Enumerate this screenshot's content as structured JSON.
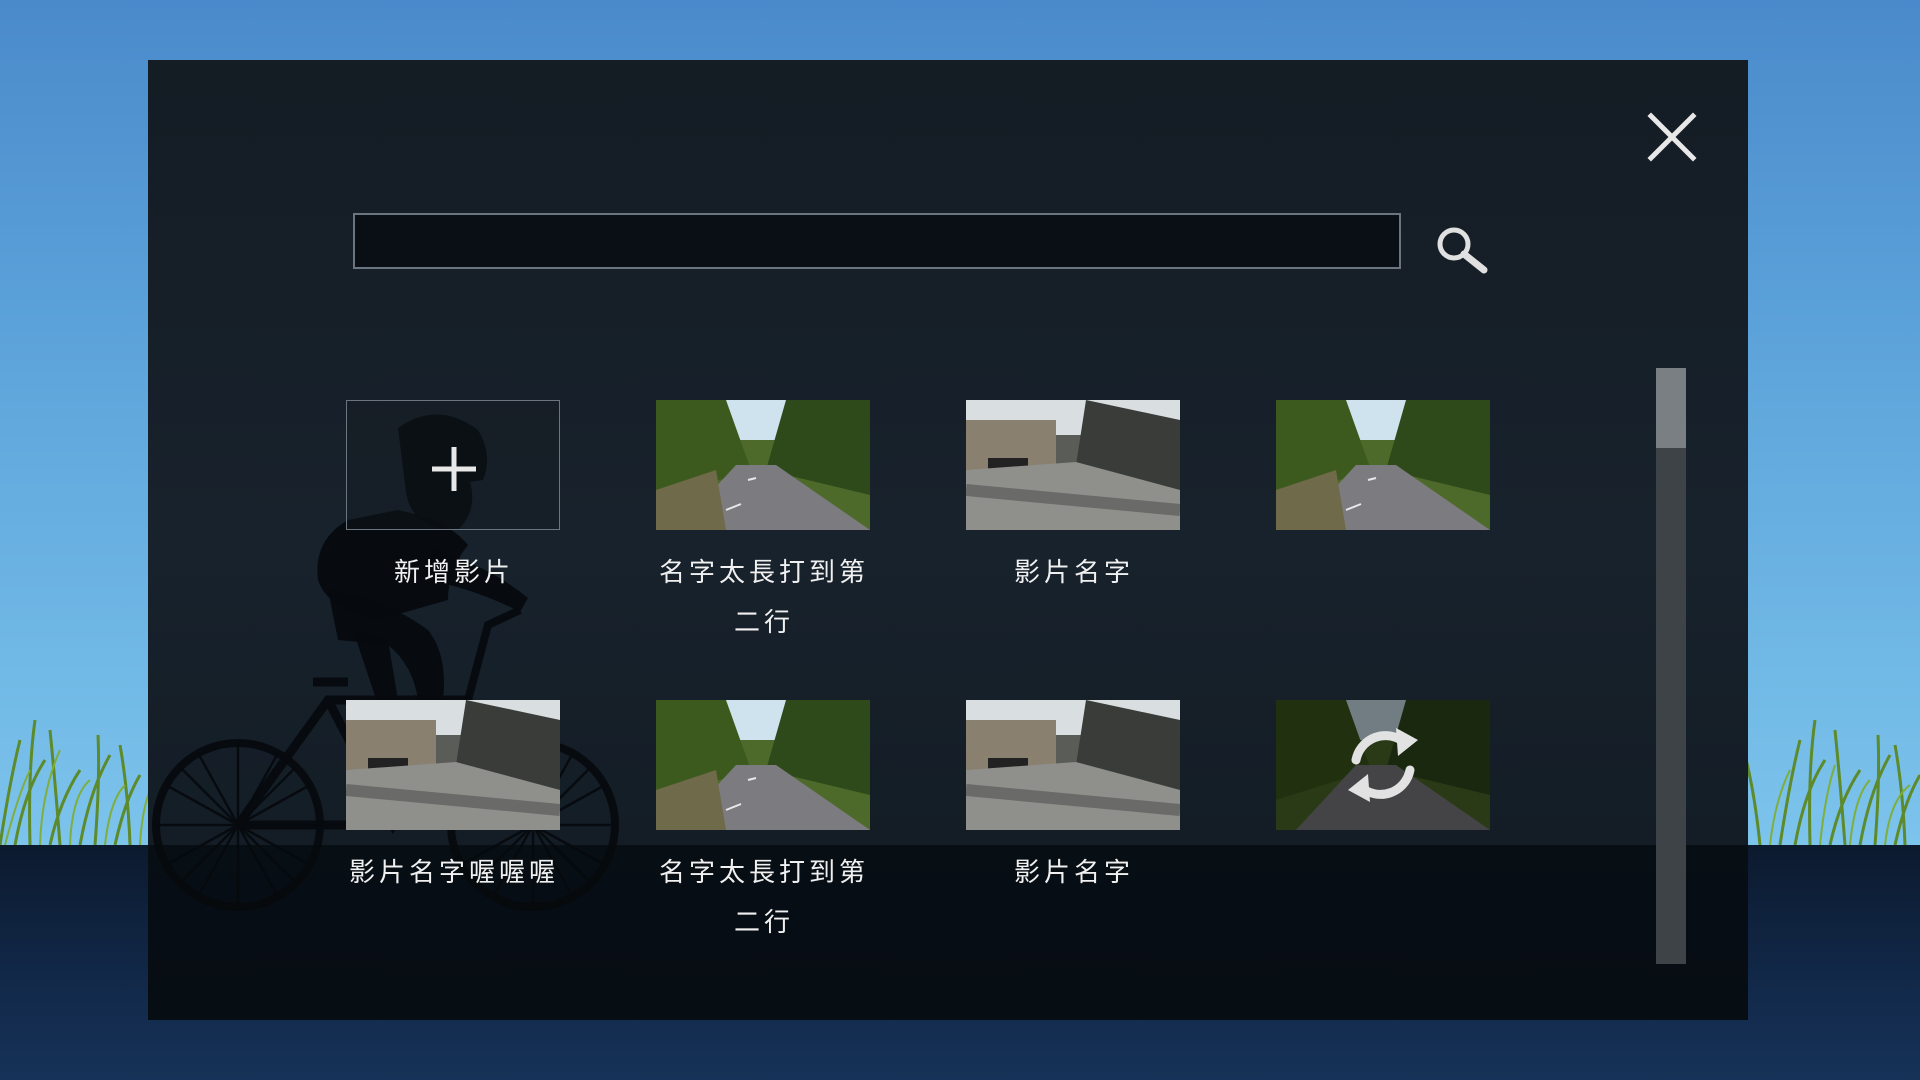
{
  "colors": {
    "accent": "#ffffff",
    "modal_bg": "#18222c",
    "search_border": "#6b7580",
    "scrollbar_track": "#3e4348",
    "scrollbar_thumb": "#7a7f84"
  },
  "header": {
    "close_icon": "close-icon",
    "search_icon": "search-icon"
  },
  "search": {
    "value": "",
    "placeholder": ""
  },
  "add_video": {
    "label": "新增影片",
    "icon": "plus-icon"
  },
  "videos": [
    {
      "label_line1": "名字太長打到第",
      "label_line2": "二行",
      "thumb": "forest-road"
    },
    {
      "label_line1": "影片名字",
      "label_line2": "",
      "thumb": "village-road"
    },
    {
      "label_line1": "",
      "label_line2": "",
      "thumb": "forest-road"
    },
    {
      "label_line1": "影片名字喔喔喔",
      "label_line2": "",
      "thumb": "village-road"
    },
    {
      "label_line1": "名字太長打到第",
      "label_line2": "二行",
      "thumb": "forest-road"
    },
    {
      "label_line1": "影片名字",
      "label_line2": "",
      "thumb": "village-road"
    },
    {
      "label_line1": "",
      "label_line2": "",
      "thumb": "forest-road",
      "overlay_icon": "refresh-icon",
      "state": "loading"
    }
  ],
  "scrollbar": {
    "position": 0.0,
    "visible_fraction": 0.13
  }
}
